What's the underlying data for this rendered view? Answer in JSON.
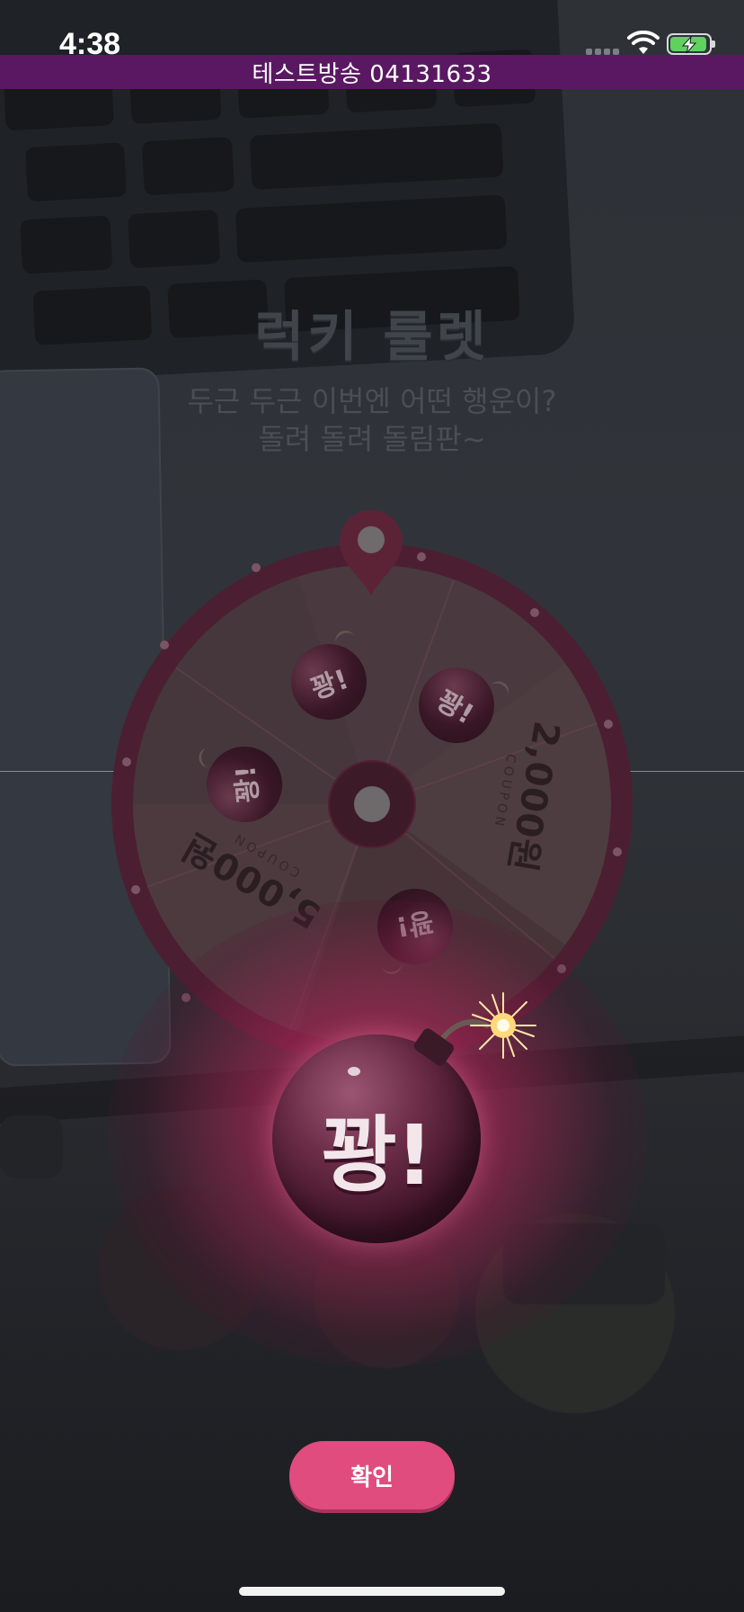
{
  "status_bar": {
    "time": "4:38",
    "icons": [
      "cellular-signal-icon",
      "wifi-icon",
      "battery-charging-icon"
    ]
  },
  "broadcast_banner": {
    "text": "테스트방송 04131633"
  },
  "roulette": {
    "title": "럭키 룰렛",
    "subtitle_lines": [
      "두근 두근 이번엔 어떤 행운이?",
      "돌려 돌려 돌림판~"
    ],
    "segments": [
      {
        "type": "bomb",
        "label": "꽝!"
      },
      {
        "type": "bomb",
        "label": "꽝!"
      },
      {
        "type": "coupon",
        "amount": "2,000원",
        "caption": "COUPON"
      },
      {
        "type": "bomb",
        "label": "꽝!"
      },
      {
        "type": "coupon",
        "amount": "5,000원",
        "caption": "COUPON"
      },
      {
        "type": "bomb",
        "label": "꽝!"
      }
    ]
  },
  "result": {
    "label": "꽝!"
  },
  "actions": {
    "confirm_label": "확인"
  },
  "colors": {
    "accent": "#e14c7e",
    "banner": "#5a1862",
    "wheel_ring": "#4b1f31"
  }
}
